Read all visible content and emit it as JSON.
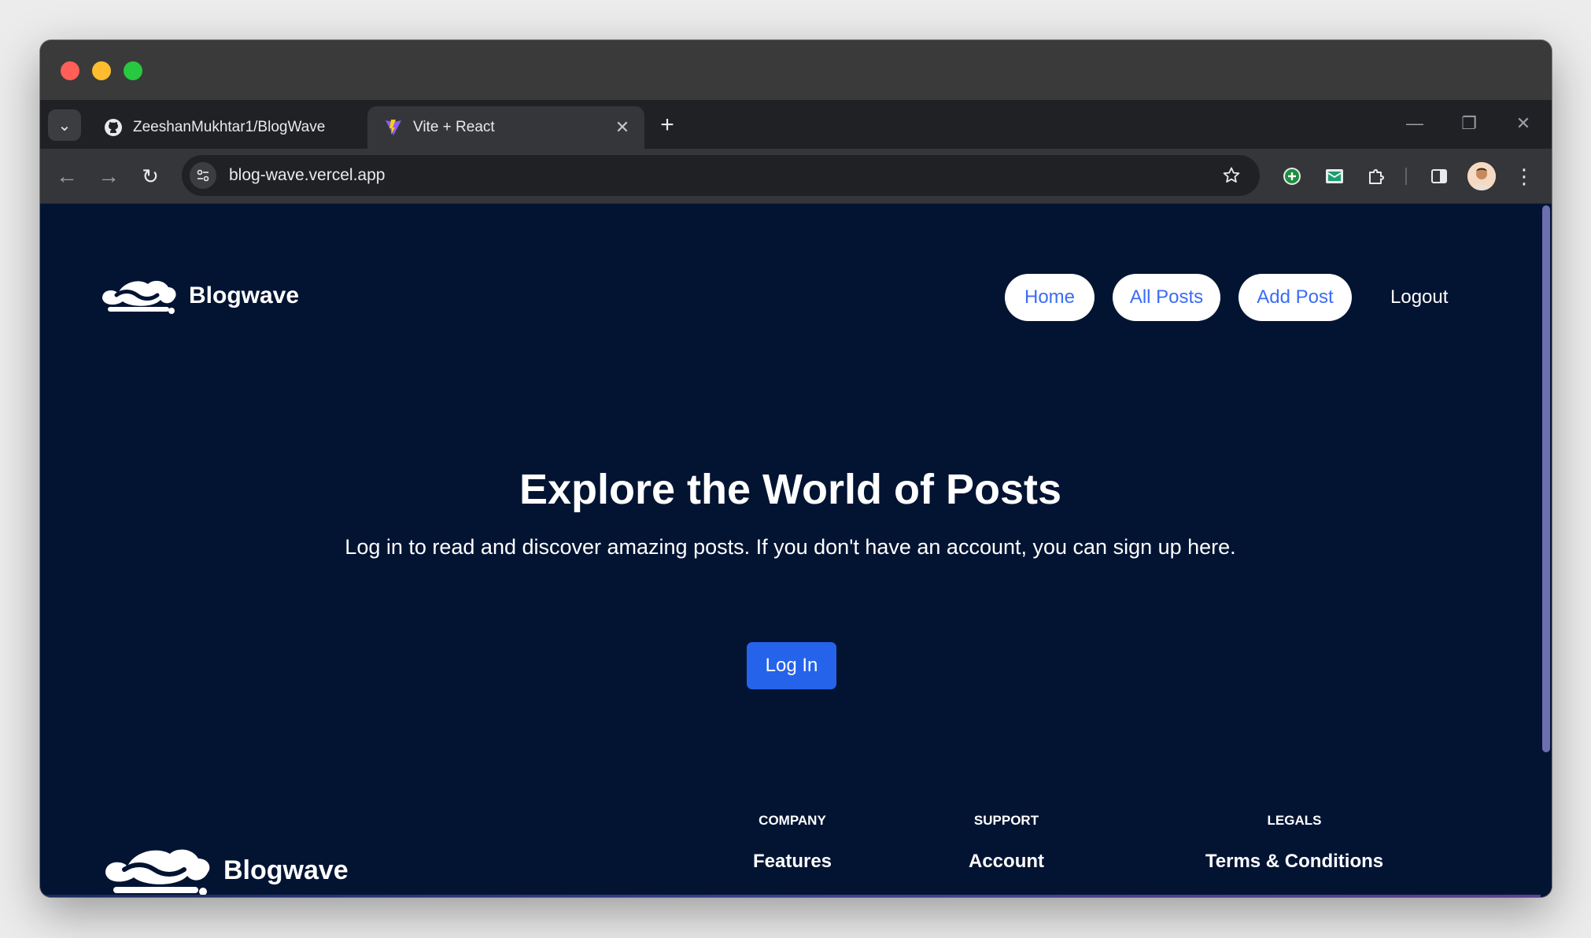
{
  "browser": {
    "tabs": [
      {
        "title": "ZeeshanMukhtar1/BlogWave",
        "icon": "github-icon",
        "active": false
      },
      {
        "title": "Vite + React",
        "icon": "vite-icon",
        "active": true
      }
    ],
    "new_tab_label": "+",
    "close_label": "✕",
    "url": "blog-wave.vercel.app"
  },
  "site": {
    "brand_name": "Blogwave",
    "nav": {
      "home": "Home",
      "all_posts": "All Posts",
      "add_post": "Add Post",
      "logout": "Logout"
    },
    "hero": {
      "title": "Explore the World of Posts",
      "subtitle": "Log in to read and discover amazing posts. If you don't have an account, you can sign up here.",
      "login_button": "Log In"
    },
    "footer": {
      "brand_name": "Blogwave",
      "company_heading": "COMPANY",
      "support_heading": "SUPPORT",
      "legal_heading": "LEGALS",
      "features_link": "Features",
      "account_link": "Account",
      "terms_link": "Terms & Conditions"
    }
  },
  "colors": {
    "page_bg": "#031433",
    "pill_bg": "#ffffff",
    "pill_text": "#3b6cf6",
    "login_button": "#2563eb"
  }
}
